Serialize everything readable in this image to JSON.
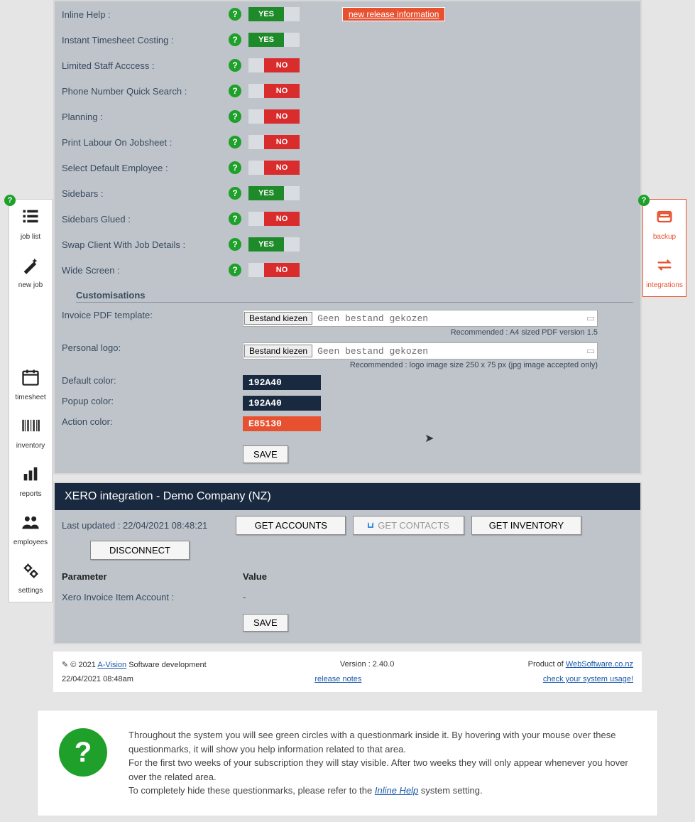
{
  "release_link": "new release information",
  "settings": [
    {
      "label": "Inline Help :",
      "value": "YES"
    },
    {
      "label": "Instant Timesheet Costing :",
      "value": "YES"
    },
    {
      "label": "Limited Staff Acccess :",
      "value": "NO"
    },
    {
      "label": "Phone Number Quick Search :",
      "value": "NO"
    },
    {
      "label": "Planning :",
      "value": "NO"
    },
    {
      "label": "Print Labour On Jobsheet :",
      "value": "NO"
    },
    {
      "label": "Select Default Employee :",
      "value": "NO"
    },
    {
      "label": "Sidebars :",
      "value": "YES"
    },
    {
      "label": "Sidebars Glued :",
      "value": "NO"
    },
    {
      "label": "Swap Client With Job Details :",
      "value": "YES"
    },
    {
      "label": "Wide Screen :",
      "value": "NO"
    }
  ],
  "customisations": {
    "heading": "Customisations",
    "invoice_label": "Invoice PDF template:",
    "logo_label": "Personal logo:",
    "file_button": "Bestand kiezen",
    "file_none": "Geen bestand gekozen",
    "invoice_rec": "Recommended : A4 sized PDF version 1.5",
    "logo_rec": "Recommended : logo image size 250 x 75 px (jpg image accepted only)",
    "default_color_label": "Default color:",
    "popup_color_label": "Popup color:",
    "action_color_label": "Action color:",
    "default_color": "192A40",
    "popup_color": "192A40",
    "action_color": "E85130",
    "save": "SAVE"
  },
  "xero": {
    "title": "XERO integration - Demo Company (NZ)",
    "last_updated": "Last updated : 22/04/2021 08:48:21",
    "btn_accounts": "GET ACCOUNTS",
    "btn_contacts": "GET CONTACTS",
    "btn_inventory": "GET INVENTORY",
    "btn_disconnect": "DISCONNECT",
    "col_param": "Parameter",
    "col_value": "Value",
    "row_param": "Xero Invoice Item Account :",
    "row_value": "-",
    "save": "SAVE"
  },
  "footer": {
    "copyright": "© 2021 ",
    "avision": "A-Vision",
    "dev": " Software development",
    "version": "Version : 2.40.0",
    "product_of": "Product of ",
    "product_link": "WebSoftware.co.nz",
    "timestamp": "22/04/2021 08:48am",
    "release_notes": "release notes",
    "usage": "check your system usage!"
  },
  "help": {
    "p1": "Throughout the system you will see green circles with a questionmark inside it. By hovering with your mouse over these questionmarks, it will show you help information related to that area.",
    "p2": "For the first two weeks of your subscription they will stay visible. After two weeks they will only appear whenever you hover over the related area.",
    "p3a": "To completely hide these questionmarks, please refer to the ",
    "p3link": "Inline Help",
    "p3b": " system setting."
  },
  "left_sidebar": [
    {
      "name": "job-list",
      "label": "job list"
    },
    {
      "name": "new-job",
      "label": "new job"
    },
    {
      "name": "timesheet",
      "label": "timesheet"
    },
    {
      "name": "inventory",
      "label": "inventory"
    },
    {
      "name": "reports",
      "label": "reports"
    },
    {
      "name": "employees",
      "label": "employees"
    },
    {
      "name": "settings",
      "label": "settings"
    }
  ],
  "right_sidebar": [
    {
      "name": "backup",
      "label": "backup"
    },
    {
      "name": "integrations",
      "label": "integrations"
    }
  ]
}
